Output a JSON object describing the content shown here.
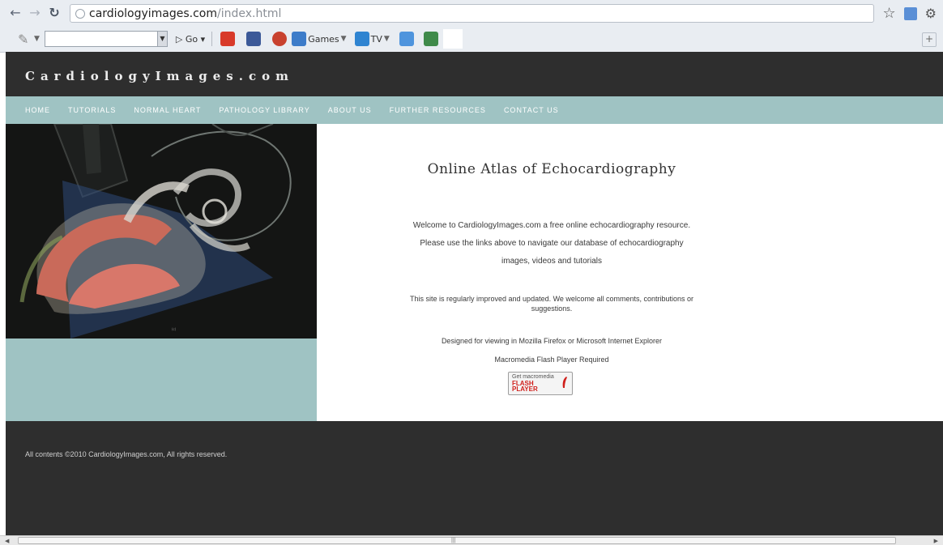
{
  "browser": {
    "url_host": "cardiologyimages.com",
    "url_path": "/index.html",
    "toolbar": {
      "go_label": "Go",
      "games_label": "Games",
      "tv_label": "TV"
    }
  },
  "site": {
    "title": "CardiologyImages.com",
    "nav": [
      {
        "label": "HOME"
      },
      {
        "label": "TUTORIALS"
      },
      {
        "label": "NORMAL HEART"
      },
      {
        "label": "PATHOLOGY LIBRARY"
      },
      {
        "label": "ABOUT US"
      },
      {
        "label": "FURTHER RESOURCES"
      },
      {
        "label": "CONTACT US"
      }
    ],
    "main": {
      "heading": "Online Atlas of Echocardiography",
      "welcome_line1": "Welcome to CardiologyImages.com a free online echocardiography resource.",
      "welcome_line2": "Please use the links above to navigate our database of echocardiography",
      "welcome_line3": "images, videos and tutorials",
      "improved_line1": "This site is regularly improved and updated. We welcome all comments, contributions or",
      "improved_line2": "suggestions.",
      "designed_for": "Designed for viewing in Mozilla Firefox or Microsoft Internet Explorer",
      "flash_required": "Macromedia Flash Player Required",
      "flash_badge": {
        "top": "Get macromedia",
        "line1": "FLASH",
        "line2": "PLAYER"
      }
    },
    "footer": {
      "copyright": "All contents ©2010 CardiologyImages.com, All rights reserved."
    }
  },
  "colors": {
    "header_bg": "#2e2e2e",
    "nav_bg": "#9fc3c3",
    "footer_bg": "#2e2e2e",
    "flash_red": "#d0201c"
  },
  "icons": [
    "back-icon",
    "forward-icon",
    "reload-icon",
    "site-info-icon",
    "star-icon",
    "page-icon",
    "wrench-icon",
    "toolbar-logo-icon",
    "youtube-icon",
    "facebook-icon",
    "games-icon",
    "tv-icon",
    "message-icon",
    "picture-icon",
    "add-icon"
  ]
}
